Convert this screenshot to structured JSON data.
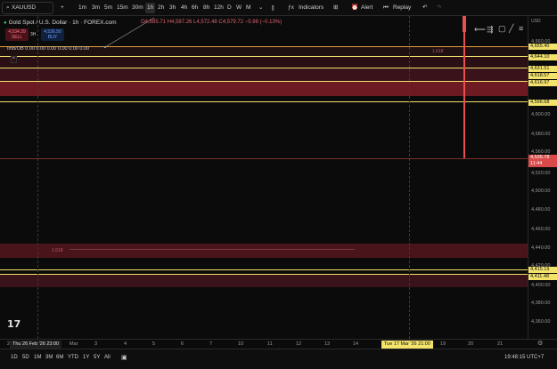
{
  "toolbar": {
    "symbol": "XAUUSD",
    "plus": "+",
    "intervals": [
      "1m",
      "3m",
      "5m",
      "15m",
      "30m",
      "1h",
      "2h",
      "3h",
      "4h",
      "6h",
      "8h",
      "12h",
      "D",
      "W",
      "M"
    ],
    "active_interval": "1h",
    "indicators_label": "Indicators",
    "alert_label": "Alert",
    "replay_label": "Replay"
  },
  "legend": {
    "title": "Gold Spot / U.S. Dollar · 1h · FOREX.com",
    "ohlc": "O4,585.71 H4,587.26 L4,572.48 C4,579.72 −5.98 (−0.13%)",
    "sell_price": "4,534.39",
    "sell_label": "SELL",
    "spread": "3H",
    "buy_price": "4,536.50",
    "buy_label": "BUY",
    "indicator": "Imb/OB 0.00 0.00 0.00 0.00 0.00 0.00",
    "collapse_icon": "^"
  },
  "chart": {
    "zone_label_top": "1.618",
    "zone_label_mid": "1.618",
    "colors": {
      "yellow": "#f3e36b",
      "orange": "#e0a23a",
      "red_zone": "#6e1a22",
      "red_candle": "#e85050",
      "dark_zone": "#2a0f14"
    }
  },
  "price_axis": {
    "ticks": [
      "4,660.00",
      "4,640.00",
      "4,620.00",
      "4,600.00",
      "4,580.00",
      "4,560.00",
      "4,540.00",
      "4,520.00",
      "4,500.00",
      "4,480.00",
      "4,460.00",
      "4,440.00",
      "4,420.00",
      "4,400.00",
      "4,380.00",
      "4,360.00"
    ],
    "labels": [
      {
        "value": "4,655.40",
        "type": "yel"
      },
      {
        "value": "4,644.10",
        "type": "yel"
      },
      {
        "value": "4,631.51",
        "type": "yel"
      },
      {
        "value": "4,618.57",
        "type": "yel"
      },
      {
        "value": "4,616.97",
        "type": "yel"
      },
      {
        "value": "4,596.68",
        "type": "yel"
      },
      {
        "value": "4,535.78",
        "type": "red"
      },
      {
        "value": "11:44",
        "type": "red"
      },
      {
        "value": "4,415.19",
        "type": "yel"
      },
      {
        "value": "4,411.48",
        "type": "yel"
      }
    ],
    "usd": "USD"
  },
  "time_axis": {
    "ticks": [
      "2",
      "Mar",
      "3",
      "4",
      "5",
      "6",
      "7",
      "10",
      "11",
      "12",
      "13",
      "14",
      "19",
      "20",
      "21"
    ],
    "left_label": "Thu 26 Feb '26   23:00",
    "right_label": "Tue 17 Mar '26   21:00"
  },
  "bottom": {
    "ranges": [
      "1D",
      "5D",
      "1M",
      "3M",
      "6M",
      "YTD",
      "1Y",
      "5Y",
      "All"
    ],
    "clock": "19:48:15 UTC+7",
    "logo": "17"
  }
}
